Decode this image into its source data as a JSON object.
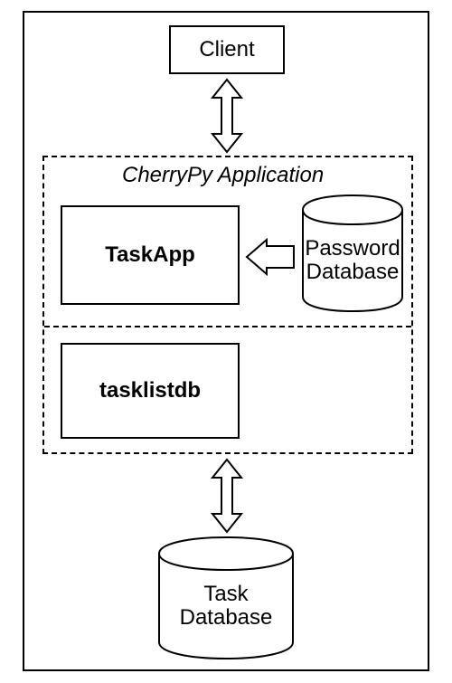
{
  "nodes": {
    "client": "Client",
    "group_title": "CherryPy Application",
    "taskapp": "TaskApp",
    "pwdb_line1": "Password",
    "pwdb_line2": "Database",
    "tasklistdb": "tasklistdb",
    "taskdb_line1": "Task",
    "taskdb_line2": "Database"
  },
  "chart_data": {
    "type": "diagram",
    "title": "",
    "nodes": [
      {
        "id": "client",
        "label": "Client",
        "shape": "rect"
      },
      {
        "id": "cherrypy_app",
        "label": "CherryPy Application",
        "shape": "group",
        "children": [
          "taskapp",
          "pwdb",
          "tasklistdb"
        ]
      },
      {
        "id": "taskapp",
        "label": "TaskApp",
        "shape": "rect"
      },
      {
        "id": "pwdb",
        "label": "Password Database",
        "shape": "cylinder"
      },
      {
        "id": "tasklistdb",
        "label": "tasklistdb",
        "shape": "rect"
      },
      {
        "id": "taskdb",
        "label": "Task Database",
        "shape": "cylinder"
      }
    ],
    "edges": [
      {
        "from": "client",
        "to": "cherrypy_app",
        "bidirectional": true
      },
      {
        "from": "pwdb",
        "to": "taskapp",
        "bidirectional": false
      },
      {
        "from": "cherrypy_app",
        "to": "taskdb",
        "bidirectional": true
      }
    ]
  }
}
